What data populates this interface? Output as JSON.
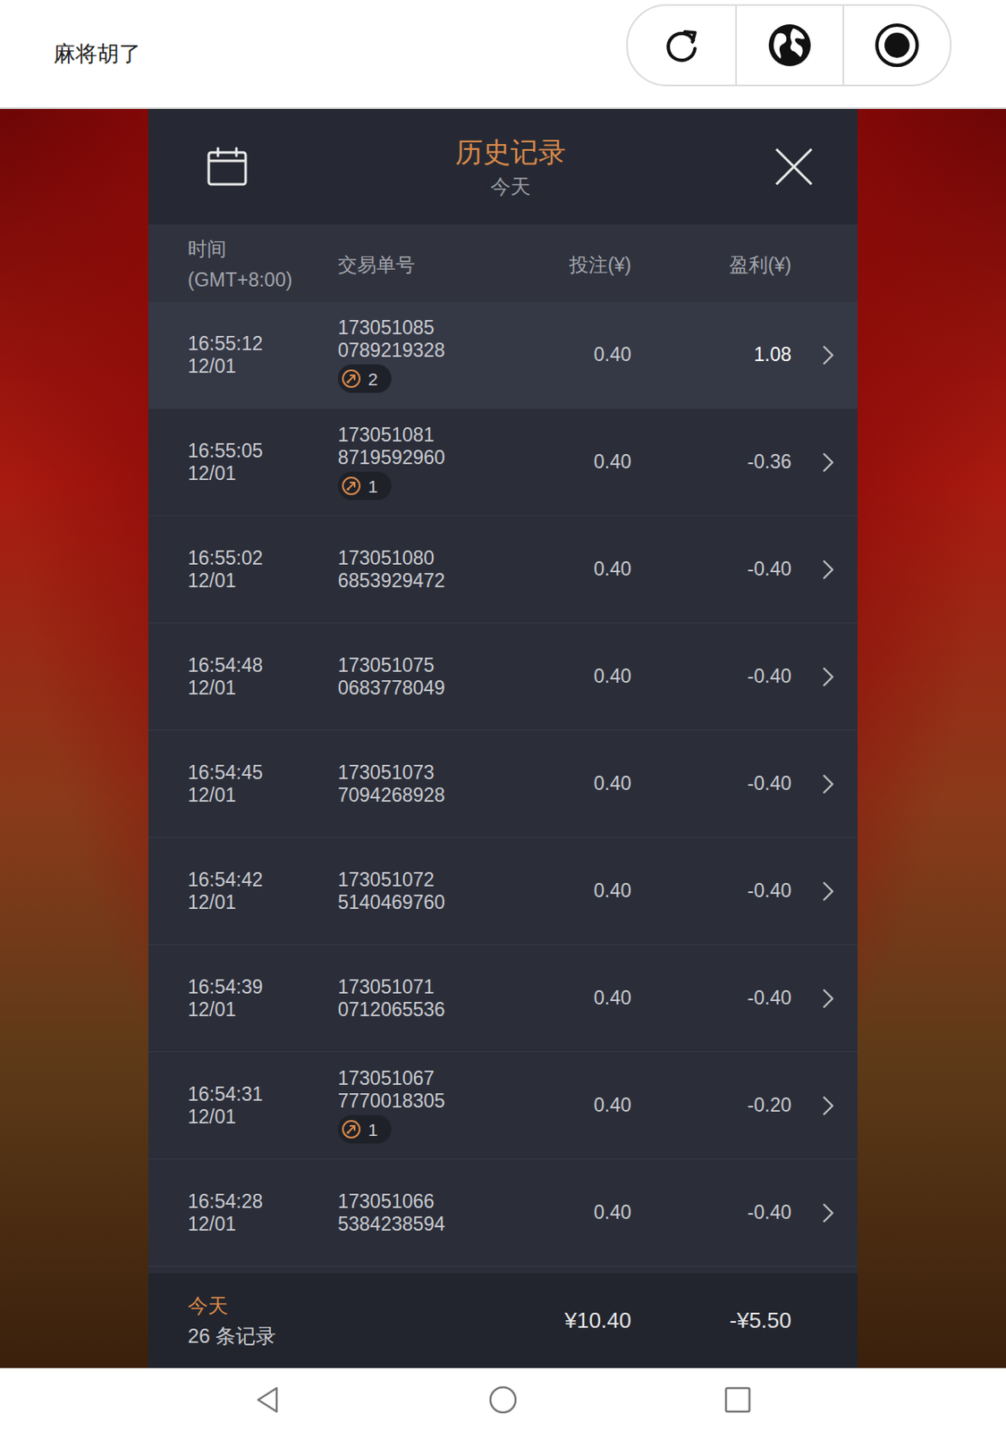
{
  "app": {
    "title": "麻将胡了"
  },
  "panel": {
    "title": "历史记录",
    "subtitle": "今天"
  },
  "table": {
    "columns": [
      {
        "label": "时间",
        "sublabel": "(GMT+8:00)"
      },
      {
        "label": "交易单号",
        "sublabel": null
      },
      {
        "label": "投注(¥)",
        "sublabel": null
      },
      {
        "label": "盈利(¥)",
        "sublabel": null
      }
    ],
    "rows": [
      {
        "time": "16:55:12",
        "date": "12/01",
        "id_line1": "173051085",
        "id_line2": "0789219328",
        "badge": "2",
        "bet": "0.40",
        "profit": "1.08",
        "positive": true,
        "highlighted": true
      },
      {
        "time": "16:55:05",
        "date": "12/01",
        "id_line1": "173051081",
        "id_line2": "8719592960",
        "badge": "1",
        "bet": "0.40",
        "profit": "-0.36",
        "positive": false,
        "highlighted": false
      },
      {
        "time": "16:55:02",
        "date": "12/01",
        "id_line1": "173051080",
        "id_line2": "6853929472",
        "badge": null,
        "bet": "0.40",
        "profit": "-0.40",
        "positive": false,
        "highlighted": false
      },
      {
        "time": "16:54:48",
        "date": "12/01",
        "id_line1": "173051075",
        "id_line2": "0683778049",
        "badge": null,
        "bet": "0.40",
        "profit": "-0.40",
        "positive": false,
        "highlighted": false
      },
      {
        "time": "16:54:45",
        "date": "12/01",
        "id_line1": "173051073",
        "id_line2": "7094268928",
        "badge": null,
        "bet": "0.40",
        "profit": "-0.40",
        "positive": false,
        "highlighted": false
      },
      {
        "time": "16:54:42",
        "date": "12/01",
        "id_line1": "173051072",
        "id_line2": "5140469760",
        "badge": null,
        "bet": "0.40",
        "profit": "-0.40",
        "positive": false,
        "highlighted": false
      },
      {
        "time": "16:54:39",
        "date": "12/01",
        "id_line1": "173051071",
        "id_line2": "0712065536",
        "badge": null,
        "bet": "0.40",
        "profit": "-0.40",
        "positive": false,
        "highlighted": false
      },
      {
        "time": "16:54:31",
        "date": "12/01",
        "id_line1": "173051067",
        "id_line2": "7770018305",
        "badge": "1",
        "bet": "0.40",
        "profit": "-0.20",
        "positive": false,
        "highlighted": false
      },
      {
        "time": "16:54:28",
        "date": "12/01",
        "id_line1": "173051066",
        "id_line2": "5384238594",
        "badge": null,
        "bet": "0.40",
        "profit": "-0.40",
        "positive": false,
        "highlighted": false
      }
    ]
  },
  "footer": {
    "label": "今天",
    "count": "26 条记录",
    "total_bet": "¥10.40",
    "total_profit": "-¥5.50"
  }
}
